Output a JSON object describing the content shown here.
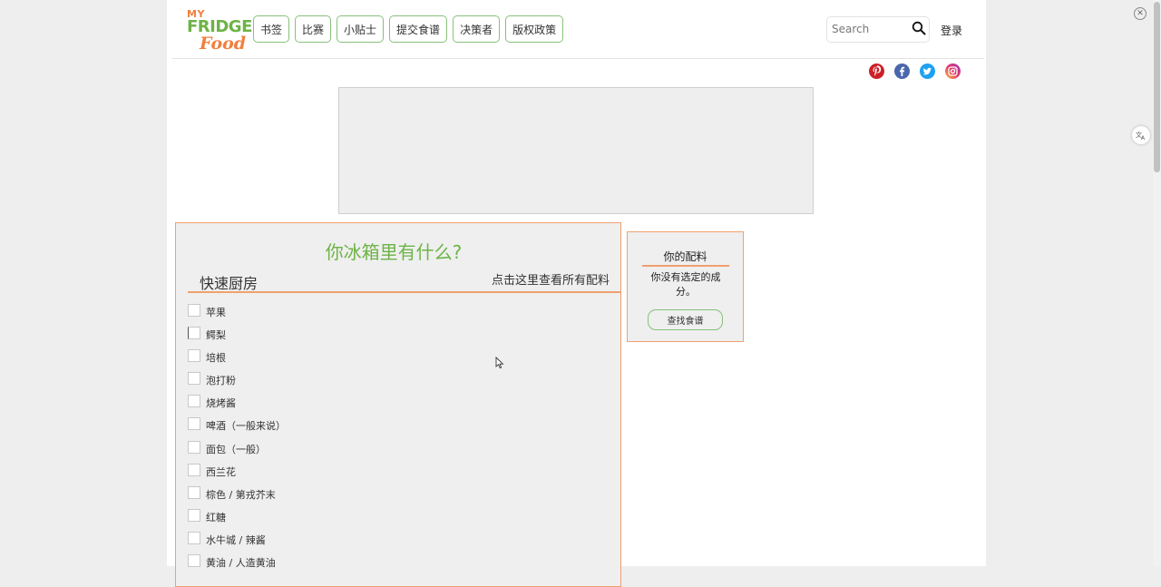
{
  "logo": {
    "line1": "MY",
    "line2": "FRIDGE",
    "line3": "Food"
  },
  "nav": [
    "书签",
    "比赛",
    "小贴士",
    "提交食谱",
    "决策者",
    "版权政策"
  ],
  "search": {
    "placeholder": "Search",
    "value": ""
  },
  "login_label": "登录",
  "social": [
    "pinterest-icon",
    "facebook-icon",
    "twitter-icon",
    "instagram-icon"
  ],
  "colors": {
    "accent_orange": "#f07f3c",
    "accent_green": "#6db347",
    "panel_bg": "#efefef"
  },
  "main": {
    "title": "你冰箱里有什么?",
    "quick_label": "快速厨房",
    "view_all_label": "点击这里查看所有配料",
    "ingredients": [
      "苹果",
      "鳄梨",
      "培根",
      "泡打粉",
      "烧烤酱",
      "啤酒（一般来说）",
      "面包（一般）",
      "西兰花",
      "棕色 / 第戎芥末",
      "红糖",
      "水牛城 / 辣酱",
      "黄油 / 人造黄油"
    ]
  },
  "side": {
    "title": "你的配料",
    "message": "你没有选定的成分。",
    "button_label": "查找食谱"
  }
}
